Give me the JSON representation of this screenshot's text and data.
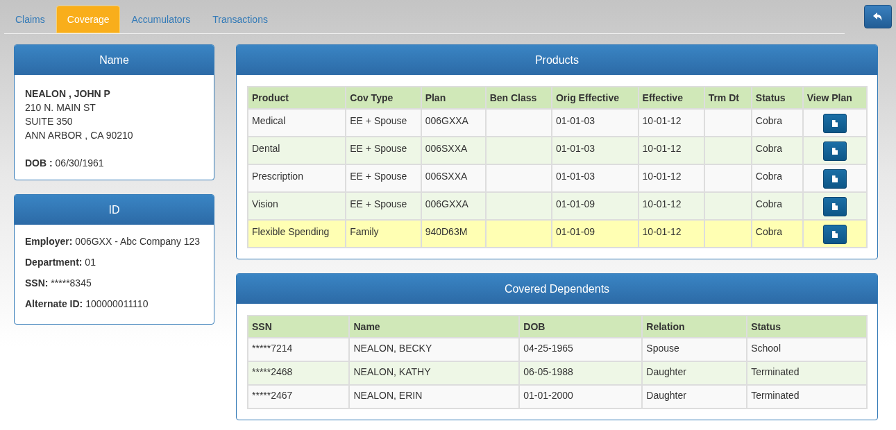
{
  "tabs": [
    {
      "label": "Claims",
      "selected": false
    },
    {
      "label": "Coverage",
      "selected": true
    },
    {
      "label": "Accumulators",
      "selected": false
    },
    {
      "label": "Transactions",
      "selected": false
    }
  ],
  "name_panel": {
    "title": "Name",
    "name": "NEALON , JOHN P",
    "address": [
      "210 N. MAIN ST",
      "SUITE 350",
      "ANN ARBOR , CA 90210"
    ],
    "dob_label": "DOB :",
    "dob": "06/30/1961"
  },
  "id_panel": {
    "title": "ID",
    "fields": [
      {
        "label": "Employer:",
        "value": "006GXX - Abc Company 123"
      },
      {
        "label": "Department:",
        "value": "01"
      },
      {
        "label": "SSN:",
        "value": "*****8345"
      },
      {
        "label": "Alternate ID:",
        "value": "100000011110"
      }
    ]
  },
  "products": {
    "title": "Products",
    "columns": [
      "Product",
      "Cov Type",
      "Plan",
      "Ben Class",
      "Orig Effective",
      "Effective",
      "Trm Dt",
      "Status",
      "View Plan"
    ],
    "rows": [
      {
        "cells": [
          "Medical",
          "EE + Spouse",
          "006GXXA",
          "",
          "01-01-03",
          "10-01-12",
          "",
          "Cobra"
        ],
        "selected": false
      },
      {
        "cells": [
          "Dental",
          "EE + Spouse",
          "006SXXA",
          "",
          "01-01-03",
          "10-01-12",
          "",
          "Cobra"
        ],
        "selected": false
      },
      {
        "cells": [
          "Prescription",
          "EE + Spouse",
          "006SXXA",
          "",
          "01-01-03",
          "10-01-12",
          "",
          "Cobra"
        ],
        "selected": false
      },
      {
        "cells": [
          "Vision",
          "EE + Spouse",
          "006GXXA",
          "",
          "01-01-09",
          "10-01-12",
          "",
          "Cobra"
        ],
        "selected": false
      },
      {
        "cells": [
          "Flexible Spending",
          "Family",
          "940D63M",
          "",
          "01-01-09",
          "10-01-12",
          "",
          "Cobra"
        ],
        "selected": true
      }
    ]
  },
  "dependents": {
    "title": "Covered Dependents",
    "columns": [
      "SSN",
      "Name",
      "DOB",
      "Relation",
      "Status"
    ],
    "rows": [
      [
        "*****7214",
        "NEALON, BECKY",
        "04-25-1965",
        "Spouse",
        "School"
      ],
      [
        "*****2468",
        "NEALON, KATHY",
        "06-05-1988",
        "Daughter",
        "Terminated"
      ],
      [
        "*****2467",
        "NEALON, ERIN",
        "01-01-2000",
        "Daughter",
        "Terminated"
      ]
    ]
  }
}
